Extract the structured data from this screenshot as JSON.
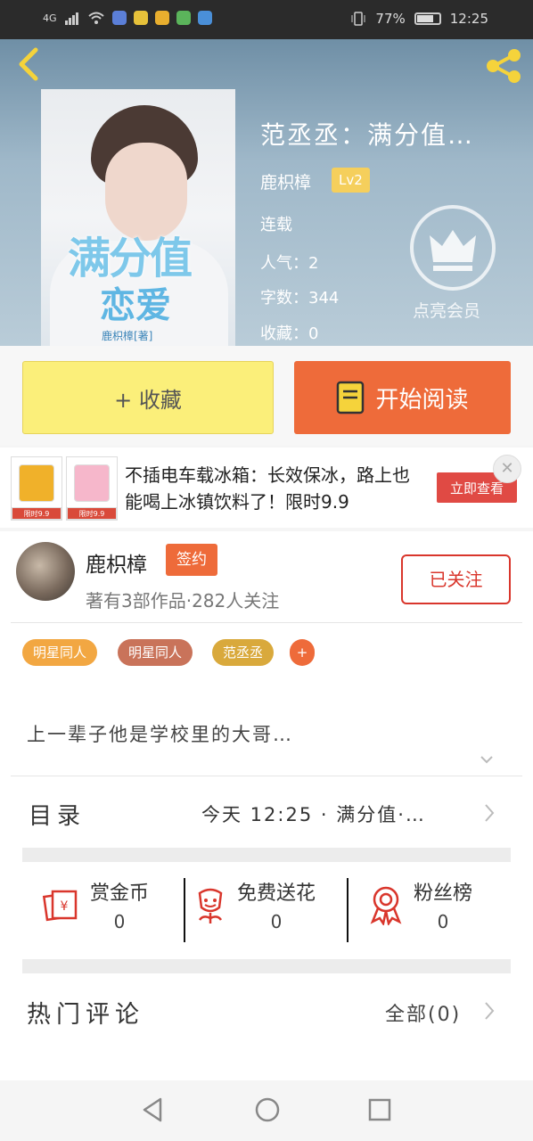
{
  "status_bar": {
    "network": "4G",
    "battery": "77%",
    "battery_level": 0.77,
    "time": "12:25"
  },
  "book": {
    "cover_title_line1": "满分值",
    "cover_title_line2": "恋爱",
    "cover_author": "鹿枳樟[著]",
    "title": "范丞丞：满分值…",
    "author": "鹿枳樟",
    "level": "Lv2",
    "status": "连载",
    "popularity": "人气：2",
    "word_count": "字数：344",
    "collections": "收藏：0"
  },
  "vip": {
    "label": "点亮会员"
  },
  "actions": {
    "favorite": "+ 收藏",
    "start_reading": "开始阅读"
  },
  "ad": {
    "text": "不插电车载冰箱：长效保冰，路上也能喝上冰镇饮料了！限时9.9",
    "button": "立即查看",
    "thumb1_price": "限时9.9",
    "thumb2_price": "限时9.9"
  },
  "author_card": {
    "name": "鹿枳樟",
    "badge": "签约",
    "stats": "著有3部作品·282人关注",
    "follow_button": "已关注"
  },
  "tags": [
    {
      "label": "明星同人",
      "color": "#f2a742"
    },
    {
      "label": "明星同人",
      "color": "#c9735a"
    },
    {
      "label": "范丞丞",
      "color": "#d9a93c"
    },
    {
      "label": "+",
      "color": "#ee6b3a"
    }
  ],
  "description": "上一辈子他是学校里的大哥…",
  "toc": {
    "label": "目录",
    "latest": "今天 12:25 · 满分值·…"
  },
  "stats": [
    {
      "label": "赏金币",
      "value": "0"
    },
    {
      "label": "免费送花",
      "value": "0"
    },
    {
      "label": "粉丝榜",
      "value": "0"
    }
  ],
  "comments": {
    "label": "热门评论",
    "all": "全部(0)"
  }
}
